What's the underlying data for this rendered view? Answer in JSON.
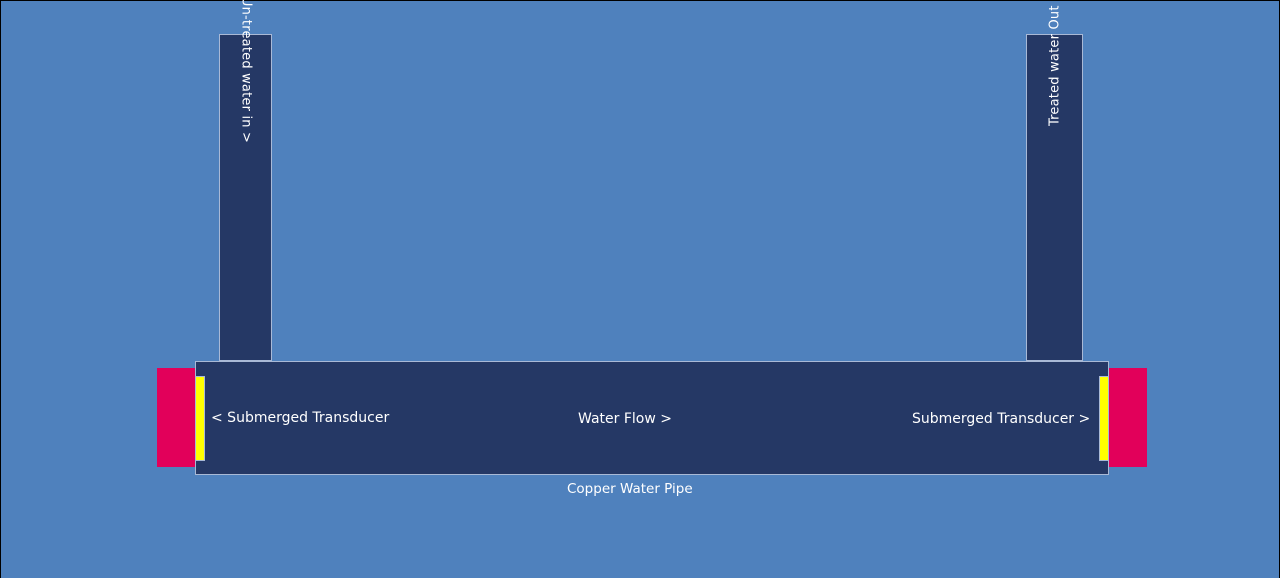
{
  "diagram": {
    "inlet_label": "Un-treated water in  >",
    "outlet_label": "Treated water Out  >",
    "left_transducer_label": "<  Submerged Transducer",
    "flow_label": "Water Flow    >",
    "right_transducer_label": "Submerged Transducer  >",
    "pipe_caption": "Copper Water Pipe"
  },
  "colors": {
    "background": "#4f81bd",
    "pipe": "#253865",
    "transducer": "#e2005a",
    "transducer_element": "#ffff00"
  }
}
